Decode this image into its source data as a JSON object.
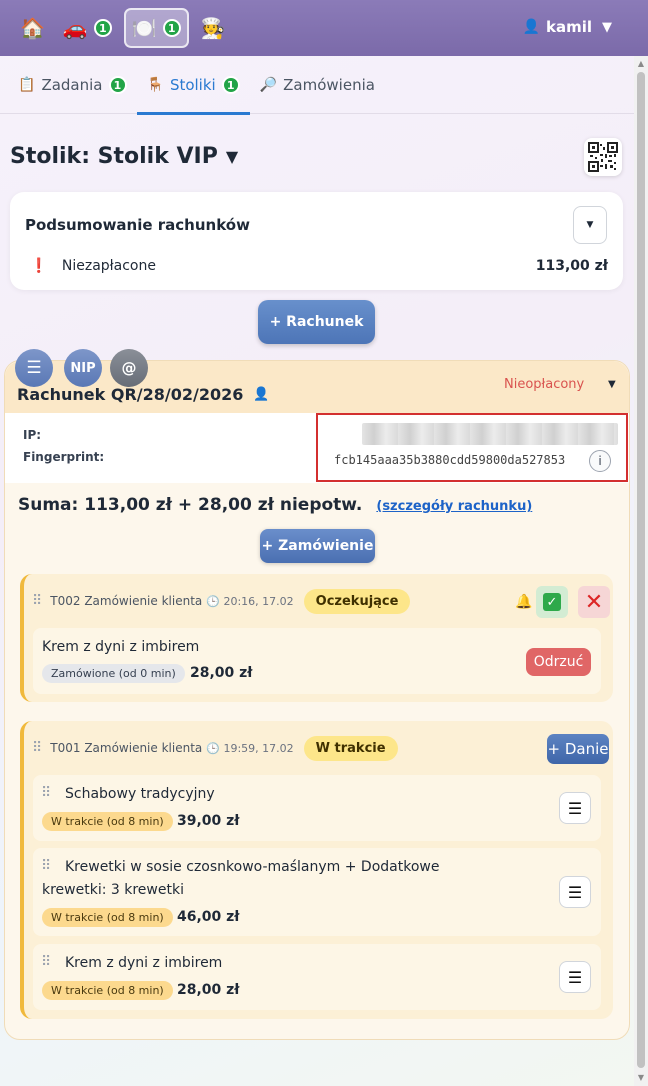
{
  "topbar": {
    "badge_count_1": "1",
    "badge_count_2": "1",
    "user_name": "kamil",
    "icons": [
      "house-icon",
      "car-icon",
      "plate-icon",
      "chef-icon",
      "user-icon"
    ]
  },
  "tabs": [
    {
      "label": "Zadania",
      "badge": "1"
    },
    {
      "label": "Stoliki",
      "badge": "1"
    },
    {
      "label": "Zamówienia"
    }
  ],
  "page": {
    "title": "Stolik: Stolik VIP",
    "caret": "▼"
  },
  "summary": {
    "title": "Podsumowanie rachunków",
    "unpaid_label": "Niezapłacone",
    "unpaid_amount": "113,00 zł"
  },
  "add_bill_label": "+ Rachunek",
  "bill": {
    "menu_glyph": "☰",
    "nip_label": "NIP",
    "at_label": "@",
    "title": "Rachunek QR/28/02/2026",
    "status": "Nieopłacony",
    "ip_label": "IP:",
    "fingerprint_label": "Fingerprint:",
    "fingerprint_value": "fcb145aaa35b3880cdd59800da527853",
    "info_glyph": "i",
    "sum_text": "Suma: 113,00 zł + 28,00 zł niepotw.",
    "details_link": "(szczegóły rachunku)",
    "add_order_label": "+ Zamówienie"
  },
  "orders": [
    {
      "label": "T002 Zamówienie klienta",
      "time": "20:16, 17.02",
      "status": "Oczekujące",
      "items": [
        {
          "name": "Krem z dyni z imbirem",
          "status": "Zamówione (od 0 min)",
          "price": "28,00 zł",
          "action": "Odrzuć"
        }
      ]
    },
    {
      "label": "T001 Zamówienie klienta",
      "time": "19:59, 17.02",
      "status": "W trakcie",
      "add_label": "+ Danie",
      "items": [
        {
          "name": "Schabowy tradycyjny",
          "status": "W trakcie (od 8 min)",
          "price": "39,00 zł"
        },
        {
          "name_line1": "Krewetki w sosie czosnkowo-maślanym + Dodatkowe",
          "name_line2": "krewetki: 3 krewetki",
          "status": "W trakcie (od 8 min)",
          "price": "46,00 zł"
        },
        {
          "name": "Krem z dyni z imbirem",
          "status": "W trakcie (od 8 min)",
          "price": "28,00 zł"
        }
      ]
    }
  ],
  "colors": {
    "topbar": "#7b6aa9",
    "accent": "#2a7ad1",
    "badge": "#22a447",
    "danger": "#e06666",
    "pending_pill": "#fde68a"
  }
}
